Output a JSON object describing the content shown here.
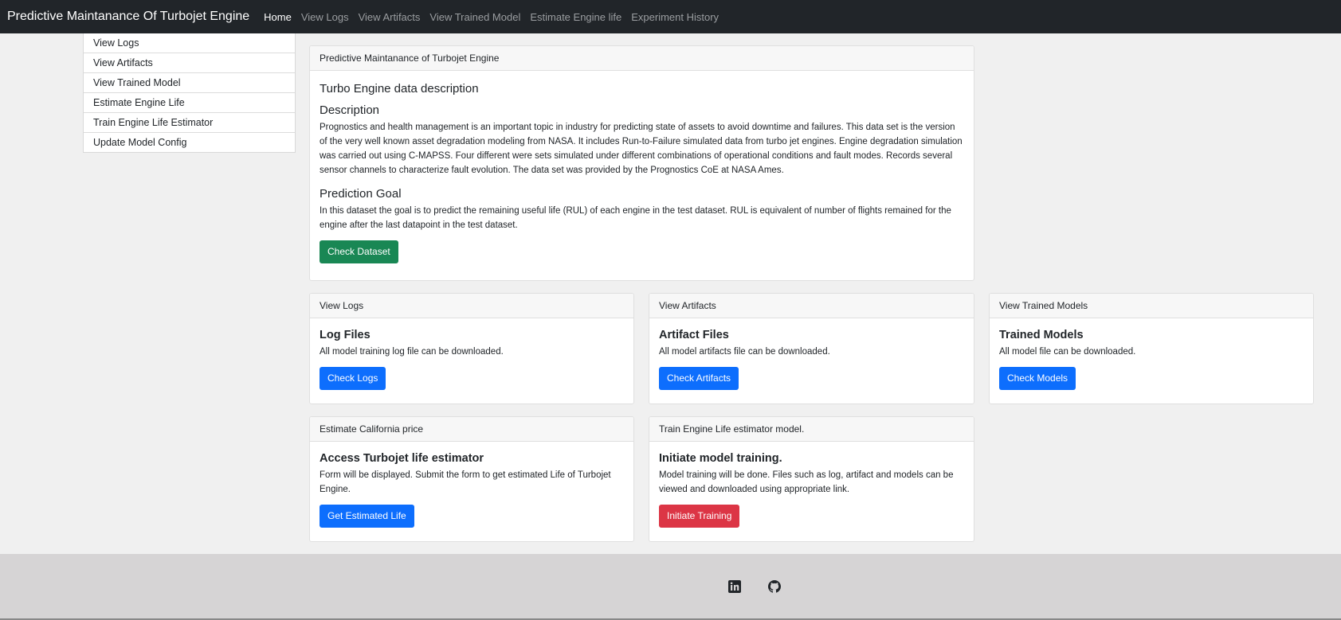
{
  "navbar": {
    "brand": "Predictive Maintanance Of Turbojet Engine",
    "links": [
      {
        "label": "Home"
      },
      {
        "label": "View Logs"
      },
      {
        "label": "View Artifacts"
      },
      {
        "label": "View Trained Model"
      },
      {
        "label": "Estimate Engine life"
      },
      {
        "label": "Experiment History"
      }
    ]
  },
  "sidebar": {
    "items": [
      {
        "label": "View Logs"
      },
      {
        "label": "View Artifacts"
      },
      {
        "label": "View Trained Model"
      },
      {
        "label": "Estimate Engine Life"
      },
      {
        "label": "Train Engine Life Estimator"
      },
      {
        "label": "Update Model Config"
      }
    ]
  },
  "main_card": {
    "header": "Predictive Maintanance of Turbojet Engine",
    "title": "Turbo Engine data description",
    "description_heading": "Description",
    "description_text": "Prognostics and health management is an important topic in industry for predicting state of assets to avoid downtime and failures. This data set is the version of the very well known asset degradation modeling from NASA. It includes Run-to-Failure simulated data from turbo jet engines. Engine degradation simulation was carried out using C-MAPSS. Four different were sets simulated under different combinations of operational conditions and fault modes. Records several sensor channels to characterize fault evolution. The data set was provided by the Prognostics CoE at NASA Ames.",
    "goal_heading": "Prediction Goal",
    "goal_text": "In this dataset the goal is to predict the remaining useful life (RUL) of each engine in the test dataset. RUL is equivalent of number of flights remained for the engine after the last datapoint in the test dataset.",
    "button": "Check Dataset"
  },
  "cards": {
    "logs": {
      "header": "View Logs",
      "title": "Log Files",
      "text": "All model training log file can be downloaded.",
      "button": "Check Logs"
    },
    "artifacts": {
      "header": "View Artifacts",
      "title": "Artifact Files",
      "text": "All model artifacts file can be downloaded.",
      "button": "Check Artifacts"
    },
    "models": {
      "header": "View Trained Models",
      "title": "Trained Models",
      "text": "All model file can be downloaded.",
      "button": "Check Models"
    },
    "estimate": {
      "header": "Estimate California price",
      "title": "Access Turbojet life estimator",
      "text": "Form will be displayed. Submit the form to get estimated Life of Turbojet Engine.",
      "button": "Get Estimated Life"
    },
    "train": {
      "header": "Train Engine Life estimator model.",
      "title": "Initiate model training.",
      "text": "Model training will be done. Files such as log, artifact and models can be viewed and downloaded using appropriate link.",
      "button": "Initiate Training"
    }
  },
  "footer": {
    "icons": [
      "linkedin-icon",
      "github-icon"
    ]
  },
  "colors": {
    "navbar_bg": "#212529",
    "green": "#198754",
    "blue": "#0d6efd",
    "red": "#dc3545",
    "footer_bg": "#d6d4d5"
  }
}
